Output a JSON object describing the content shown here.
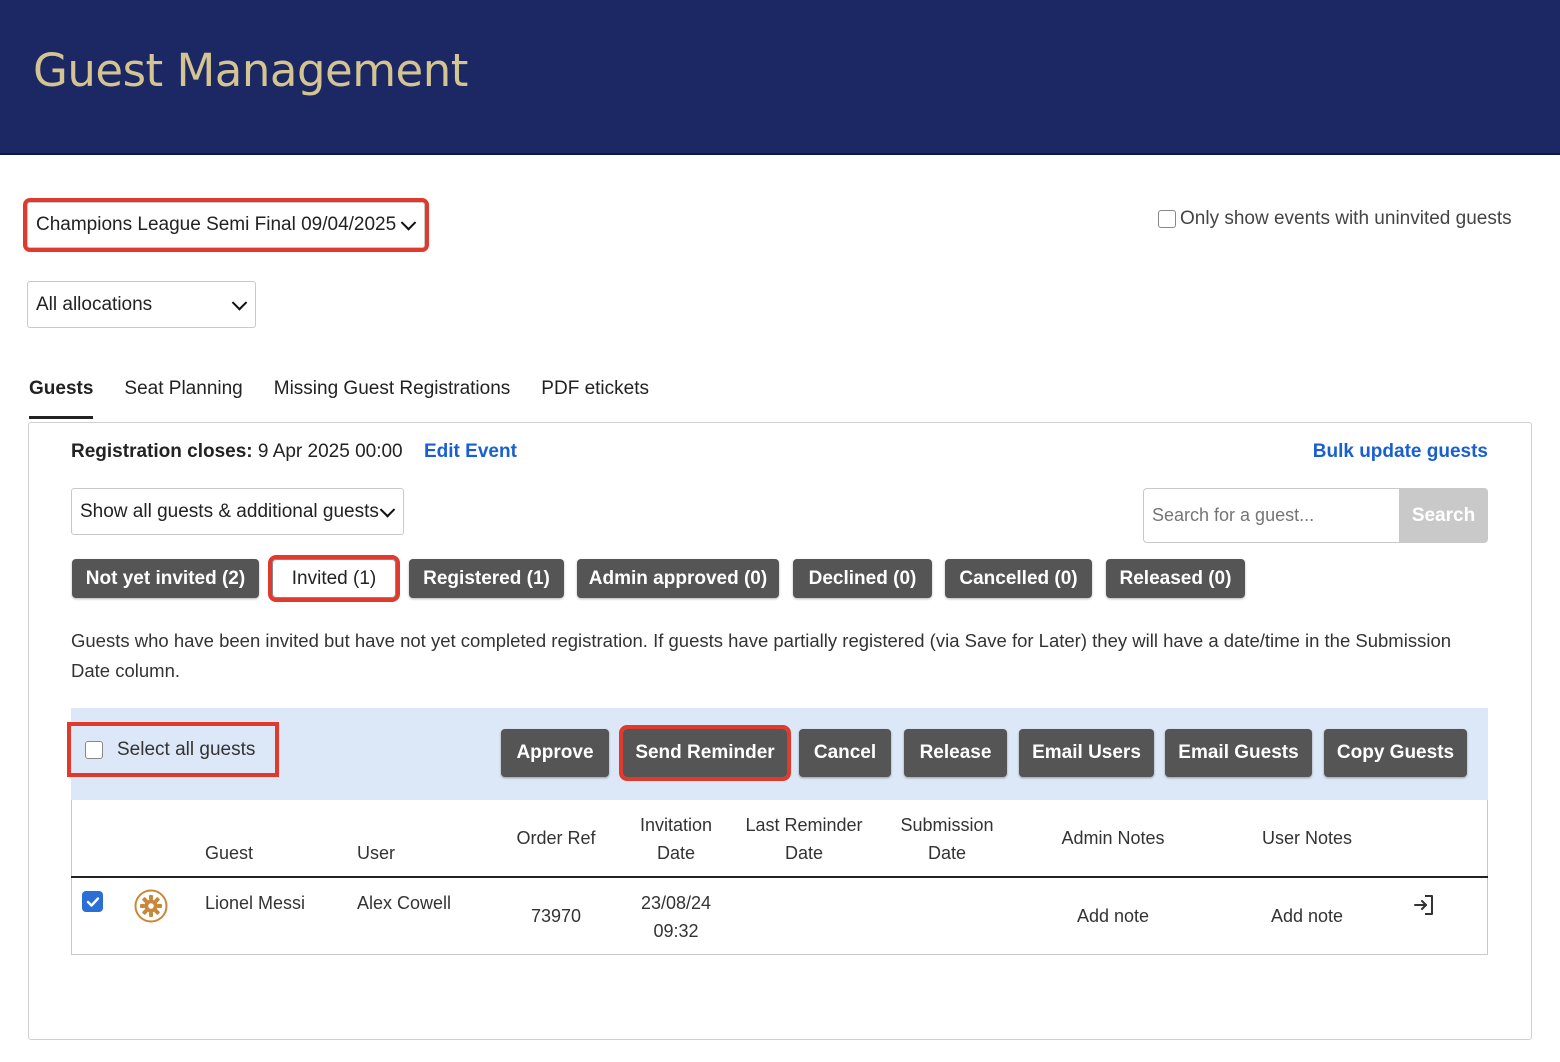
{
  "header": {
    "title": "Guest Management"
  },
  "event_select": {
    "value": "Champions League Semi Final 09/04/2025"
  },
  "allocation_select": {
    "value": "All allocations"
  },
  "only_show_uninvited": {
    "label": "Only show events with uninvited guests",
    "checked": false
  },
  "tabs": [
    {
      "label": "Guests",
      "active": true
    },
    {
      "label": "Seat Planning",
      "active": false
    },
    {
      "label": "Missing Guest Registrations",
      "active": false
    },
    {
      "label": "PDF etickets",
      "active": false
    }
  ],
  "panel": {
    "registration_closes_label": "Registration closes:",
    "registration_closes_value": "9 Apr 2025 00:00",
    "edit_event": "Edit Event",
    "bulk_update": "Bulk update guests",
    "guest_filter": "Show all guests & additional guests",
    "search_placeholder": "Search for a guest...",
    "search_button": "Search",
    "status_filters": [
      {
        "label": "Not yet invited (2)",
        "selected": false
      },
      {
        "label": "Invited (1)",
        "selected": true
      },
      {
        "label": "Registered (1)",
        "selected": false
      },
      {
        "label": "Admin approved (0)",
        "selected": false
      },
      {
        "label": "Declined (0)",
        "selected": false
      },
      {
        "label": "Cancelled (0)",
        "selected": false
      },
      {
        "label": "Released (0)",
        "selected": false
      }
    ],
    "description": "Guests who have been invited but have not yet completed registration. If guests have partially registered (via Save for Later) they will have a date/time in the Submission Date column.",
    "select_all": "Select all guests",
    "actions": {
      "approve": "Approve",
      "send_reminder": "Send Reminder",
      "cancel": "Cancel",
      "release": "Release",
      "email_users": "Email Users",
      "email_guests": "Email Guests",
      "copy_guests": "Copy Guests"
    },
    "table": {
      "headers": {
        "guest": "Guest",
        "user": "User",
        "order_ref": "Order Ref",
        "invitation_date_1": "Invitation",
        "invitation_date_2": "Date",
        "last_reminder_1": "Last Reminder",
        "last_reminder_2": "Date",
        "submission_1": "Submission",
        "submission_2": "Date",
        "admin_notes": "Admin Notes",
        "user_notes": "User Notes"
      },
      "rows": [
        {
          "checked": true,
          "guest": "Lionel Messi",
          "user": "Alex Cowell",
          "order_ref": "73970",
          "invitation_date": "23/08/24",
          "invitation_time": "09:32",
          "admin_notes": "Add note",
          "user_notes": "Add note"
        }
      ]
    }
  },
  "colors": {
    "header_bg": "#1b2863",
    "header_title": "#d4c491",
    "highlight": "#e03a2c",
    "link": "#1a5fd1",
    "button": "#555555",
    "action_bar": "#dce8f7"
  }
}
